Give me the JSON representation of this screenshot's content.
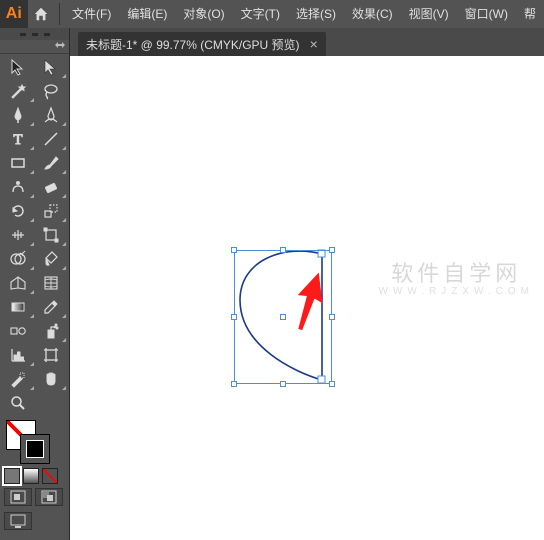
{
  "app": {
    "logo": "Ai"
  },
  "menu": [
    "文件(F)",
    "编辑(E)",
    "对象(O)",
    "文字(T)",
    "选择(S)",
    "效果(C)",
    "视图(V)",
    "窗口(W)",
    "帮"
  ],
  "document": {
    "tab_label": "未标题-1* @ 99.77%  (CMYK/GPU 预览)",
    "close_label": "×"
  },
  "watermark": {
    "cn": "软件自学网",
    "en": "WWW.RJZXW.COM"
  },
  "colors": {
    "selection": "#4a90d9",
    "arrow": "#ff1a1a",
    "shape_stroke": "#1a3a8a",
    "brand": "#ff7f18"
  },
  "tools": [
    {
      "name": "selection-tool",
      "icon": "cursor",
      "sub": false
    },
    {
      "name": "direct-selection-tool",
      "icon": "cursor-white",
      "sub": true
    },
    {
      "name": "magic-wand-tool",
      "icon": "wand",
      "sub": true
    },
    {
      "name": "lasso-tool",
      "icon": "lasso",
      "sub": false
    },
    {
      "name": "pen-tool",
      "icon": "pen",
      "sub": true
    },
    {
      "name": "curvature-tool",
      "icon": "curve-pen",
      "sub": true
    },
    {
      "name": "type-tool",
      "icon": "type",
      "sub": true
    },
    {
      "name": "line-tool",
      "icon": "line",
      "sub": true
    },
    {
      "name": "rectangle-tool",
      "icon": "rect",
      "sub": true
    },
    {
      "name": "paintbrush-tool",
      "icon": "brush",
      "sub": true
    },
    {
      "name": "shaper-tool",
      "icon": "shaper",
      "sub": true
    },
    {
      "name": "eraser-tool",
      "icon": "eraser",
      "sub": true
    },
    {
      "name": "rotate-tool",
      "icon": "rotate",
      "sub": true
    },
    {
      "name": "scale-tool",
      "icon": "scale",
      "sub": true
    },
    {
      "name": "width-tool",
      "icon": "width",
      "sub": true
    },
    {
      "name": "free-transform-tool",
      "icon": "transform",
      "sub": true
    },
    {
      "name": "shape-builder-tool",
      "icon": "shapebuilder",
      "sub": true
    },
    {
      "name": "live-paint-tool",
      "icon": "livepaint",
      "sub": true
    },
    {
      "name": "perspective-grid-tool",
      "icon": "perspective",
      "sub": true
    },
    {
      "name": "mesh-tool",
      "icon": "mesh",
      "sub": false
    },
    {
      "name": "gradient-tool",
      "icon": "gradient",
      "sub": true
    },
    {
      "name": "eyedropper-tool",
      "icon": "eyedropper",
      "sub": true
    },
    {
      "name": "blend-tool",
      "icon": "blend",
      "sub": false
    },
    {
      "name": "symbol-sprayer-tool",
      "icon": "spray",
      "sub": true
    },
    {
      "name": "column-graph-tool",
      "icon": "graph",
      "sub": true
    },
    {
      "name": "artboard-tool",
      "icon": "artboard",
      "sub": false
    },
    {
      "name": "slice-tool",
      "icon": "slice",
      "sub": true
    },
    {
      "name": "hand-tool",
      "icon": "hand",
      "sub": true
    },
    {
      "name": "zoom-tool",
      "icon": "zoom",
      "sub": false
    },
    {
      "name": "spacer",
      "icon": "",
      "sub": false
    }
  ],
  "fillstroke": {
    "fill": "none",
    "stroke": "#000000"
  }
}
